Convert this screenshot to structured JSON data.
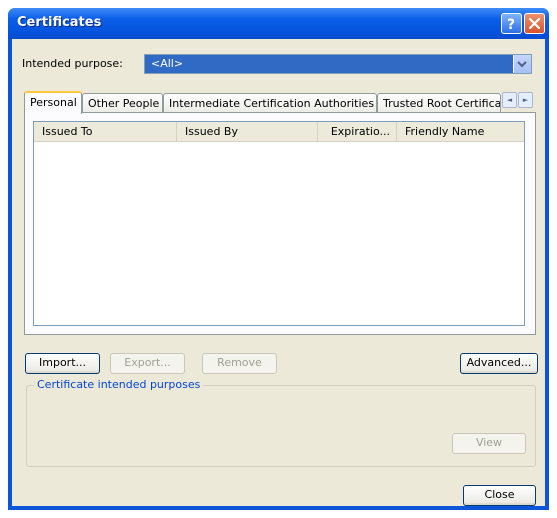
{
  "window": {
    "title": "Certificates",
    "help_glyph": "?",
    "close_glyph": "×"
  },
  "purpose": {
    "label": "Intended purpose:",
    "value": "<All>"
  },
  "tabs": [
    {
      "label": "Personal",
      "active": true
    },
    {
      "label": "Other People",
      "active": false
    },
    {
      "label": "Intermediate Certification Authorities",
      "active": false
    },
    {
      "label": "Trusted Root Certification",
      "active": false
    }
  ],
  "tab_scroll": {
    "left": "◄",
    "right": "►"
  },
  "list": {
    "columns": [
      "Issued To",
      "Issued By",
      "Expiratio...",
      "Friendly Name"
    ],
    "rows": []
  },
  "buttons": {
    "import": "Import...",
    "export": "Export...",
    "remove": "Remove",
    "advanced": "Advanced...",
    "view": "View",
    "close": "Close"
  },
  "purposes_group": {
    "title": "Certificate intended purposes"
  },
  "colors": {
    "title_bar": "#0553dc",
    "selection": "#316ac5",
    "dialog_bg": "#ece9d8",
    "active_tab_highlight": "#ffc83c",
    "group_title": "#0046d5"
  }
}
